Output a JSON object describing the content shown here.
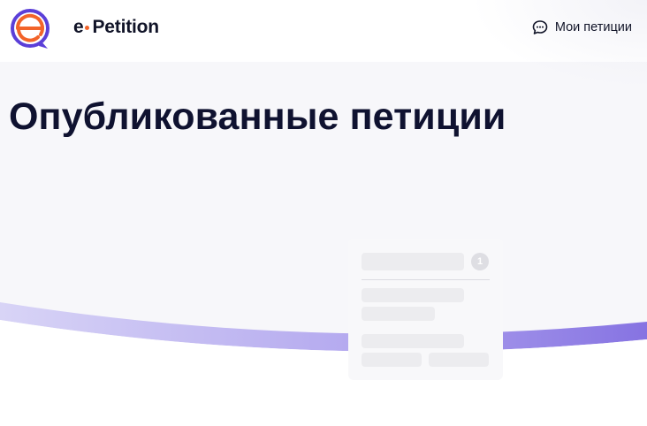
{
  "header": {
    "logo_icon": "epetition-logo-icon",
    "brand_prefix": "e",
    "brand_name": "Petition",
    "my_petitions_label": "Мои петиции",
    "my_petitions_icon": "chat-bubble-icon"
  },
  "main": {
    "title": "Опубликованные петиции",
    "skeleton_card": {
      "badge_number": "1"
    }
  },
  "colors": {
    "logo_orange": "#f2642a",
    "logo_purple": "#5b3fd8",
    "wave_start": "#d8d4f6",
    "wave_end": "#8673e2",
    "title": "#0f1230"
  }
}
